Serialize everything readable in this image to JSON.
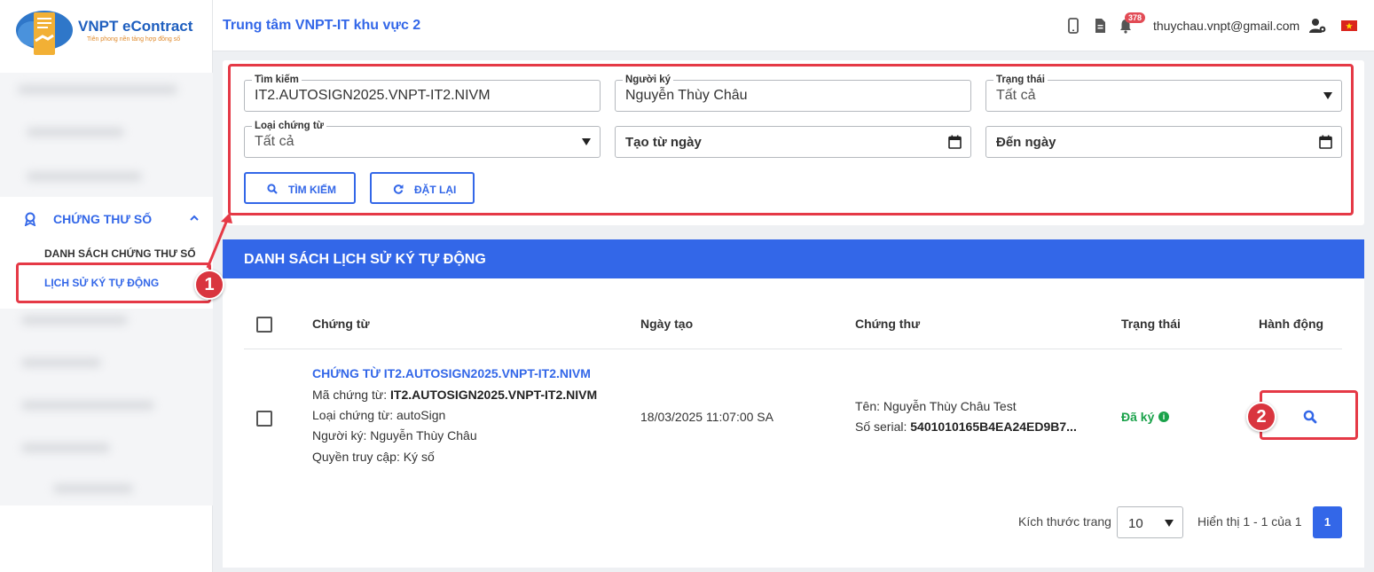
{
  "brand": {
    "name": "VNPT eContract",
    "tagline": "Tiên phong nền tảng hợp đồng số"
  },
  "sidebar": {
    "group_label": "CHỨNG THƯ SỐ",
    "items": [
      {
        "label": "DANH SÁCH CHỨNG THƯ SỐ",
        "active": false
      },
      {
        "label": "LỊCH SỬ KÝ TỰ ĐỘNG",
        "active": true
      }
    ]
  },
  "header": {
    "title": "Trung tâm VNPT-IT khu vực 2",
    "notification_count": "378",
    "user_email": "thuychau.vnpt@gmail.com"
  },
  "search": {
    "keyword": {
      "label": "Tìm kiếm",
      "value": "IT2.AUTOSIGN2025.VNPT-IT2.NIVM"
    },
    "signer": {
      "label": "Người ký",
      "value": "Nguyễn Thùy Châu"
    },
    "status": {
      "label": "Trạng thái",
      "value": "Tất cả"
    },
    "doc_type": {
      "label": "Loại chứng từ",
      "value": "Tất cả"
    },
    "from_date": {
      "placeholder": "Tạo từ ngày"
    },
    "to_date": {
      "placeholder": "Đến ngày"
    },
    "search_button": "TÌM KIẾM",
    "reset_button": "ĐẶT LẠI"
  },
  "list": {
    "title": "DANH SÁCH LỊCH SỬ KÝ TỰ ĐỘNG",
    "columns": {
      "document": "Chứng từ",
      "created": "Ngày tạo",
      "certificate": "Chứng thư",
      "status": "Trạng thái",
      "actions": "Hành động"
    },
    "rows": [
      {
        "doc_title": "CHỨNG TỪ IT2.AUTOSIGN2025.VNPT-IT2.NIVM",
        "doc_code_label": "Mã chứng từ: ",
        "doc_code": "IT2.AUTOSIGN2025.VNPT-IT2.NIVM",
        "doc_type": "Loại chứng từ: autoSign",
        "signer": "Người ký: Nguyễn Thùy Châu",
        "access": "Quyền truy cập: Ký số",
        "created": "18/03/2025 11:07:00 SA",
        "cert_name": "Tên: Nguyễn Thùy Châu Test",
        "serial_label": "Số serial: ",
        "serial": "5401010165B4EA24ED9B7...",
        "status": "Đã ký"
      }
    ]
  },
  "pagination": {
    "page_size_label": "Kích thước trang",
    "page_size": "10",
    "summary": "Hiển thị 1 - 1 của 1",
    "current_page": "1"
  },
  "annotations": {
    "step1": "1",
    "step2": "2"
  },
  "colors": {
    "primary": "#3367e8",
    "success": "#1aa24a",
    "annotation": "#e53946"
  }
}
